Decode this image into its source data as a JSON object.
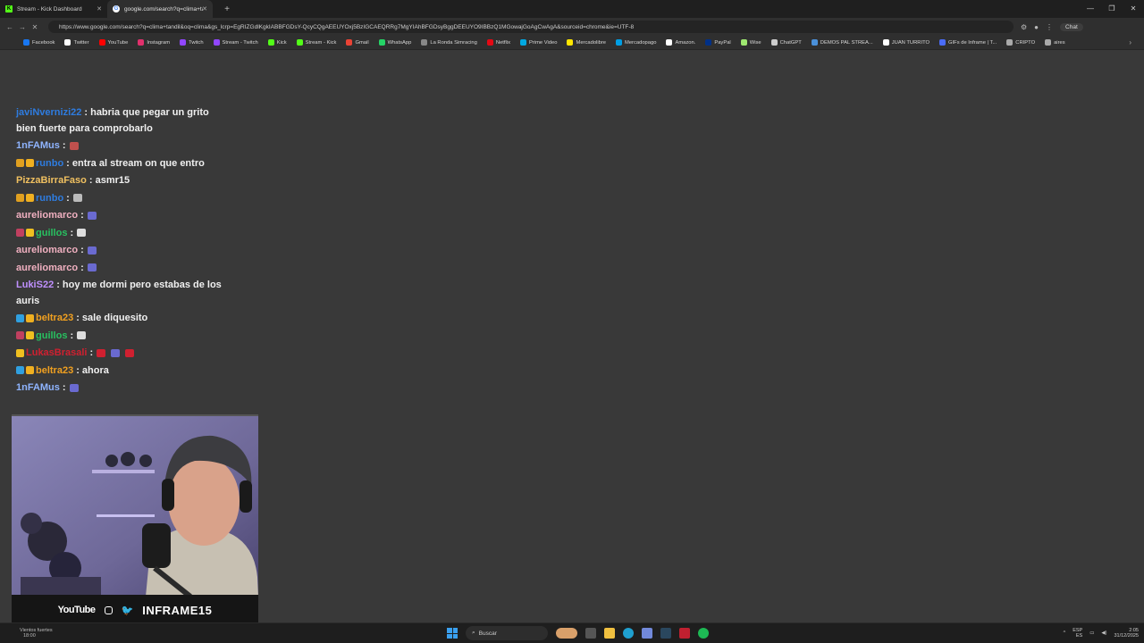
{
  "browser": {
    "tabs": [
      {
        "title": "Stream - Kick Dashboard",
        "favicon_color": "#53fc18"
      },
      {
        "title": "google.com/search?q=clima+tan",
        "favicon_color": "#4285f4"
      }
    ],
    "url": "https://www.google.com/search?q=clima+tandil&oq=clima&gs_lcrp=EgRIZGdlKgkIABBFGDsY-QcyCQgAEEUYOxj5BzIGCAEQRRg7MgYIAhBFGDsyBggDEEUYO9IBBzQ1MGowajGoAgCwAgA&sourceid=chrome&ie=UTF-8",
    "chat_button": "Chat",
    "bookmarks": [
      {
        "label": "Facebook",
        "color": "#1877f2"
      },
      {
        "label": "Twitter",
        "color": "#ffffff"
      },
      {
        "label": "YouTube",
        "color": "#ff0000"
      },
      {
        "label": "Instagram",
        "color": "#e1306c"
      },
      {
        "label": "Twitch",
        "color": "#9146ff"
      },
      {
        "label": "Stream - Twitch",
        "color": "#9146ff"
      },
      {
        "label": "Kick",
        "color": "#53fc18"
      },
      {
        "label": "Stream - Kick",
        "color": "#53fc18"
      },
      {
        "label": "Gmail",
        "color": "#ea4335"
      },
      {
        "label": "WhatsApp",
        "color": "#25d366"
      },
      {
        "label": "La Ronda Simracing",
        "color": "#888888"
      },
      {
        "label": "Netflix",
        "color": "#e50914"
      },
      {
        "label": "Prime Video",
        "color": "#00a8e1"
      },
      {
        "label": "Mercadolibre",
        "color": "#ffe600"
      },
      {
        "label": "Mercadopago",
        "color": "#009ee3"
      },
      {
        "label": "Amazon.",
        "color": "#ffffff"
      },
      {
        "label": "PayPal",
        "color": "#003087"
      },
      {
        "label": "Wise",
        "color": "#9fe870"
      },
      {
        "label": "ChatGPT",
        "color": "#cccccc"
      },
      {
        "label": "DEMOS PAL STREA...",
        "color": "#4a90d9"
      },
      {
        "label": "JUAN TURRITO",
        "color": "#ffffff"
      },
      {
        "label": "GIFs de Inframe | T...",
        "color": "#4a6cf7"
      },
      {
        "label": "CRIPTO",
        "color": "#aaaaaa"
      },
      {
        "label": "aires",
        "color": "#aaaaaa"
      }
    ]
  },
  "chat": [
    {
      "user": "javiNvernizi22",
      "color": "#2e7ce0",
      "text": ": habria que pegar un grito bien fuerte para comprobarlo",
      "badges": [],
      "emotes": []
    },
    {
      "user": "1nFAMus",
      "color": "#8fb4ff",
      "text": ":",
      "badges": [],
      "emotes": [
        "#c0504d"
      ]
    },
    {
      "user": "runbo",
      "color": "#2e7ce0",
      "text": ": entra al stream on que entro",
      "badges": [
        "#e0a020",
        "#f0b020"
      ],
      "emotes": []
    },
    {
      "user": "PizzaBirraFaso",
      "color": "#f0c060",
      "text": ": asmr15",
      "badges": [],
      "emotes": []
    },
    {
      "user": "runbo",
      "color": "#2e7ce0",
      "text": ":",
      "badges": [
        "#e0a020",
        "#f0b020"
      ],
      "emotes": [
        "#bbbbbb"
      ]
    },
    {
      "user": "aureliomarco",
      "color": "#f0b0c0",
      "text": ":",
      "badges": [],
      "emotes": [
        "#6a6ad0"
      ]
    },
    {
      "user": "guillos",
      "color": "#28c060",
      "text": ":",
      "badges": [
        "#c04060",
        "#f0c020"
      ],
      "emotes": [
        "#dddddd"
      ]
    },
    {
      "user": "aureliomarco",
      "color": "#f0b0c0",
      "text": ":",
      "badges": [],
      "emotes": [
        "#6a6ad0"
      ]
    },
    {
      "user": "aureliomarco",
      "color": "#f0b0c0",
      "text": ":",
      "badges": [],
      "emotes": [
        "#6a6ad0"
      ]
    },
    {
      "user": "LukiS22",
      "color": "#c090ff",
      "text": ": hoy me dormi pero estabas de los auris",
      "badges": [],
      "emotes": []
    },
    {
      "user": "beltra23",
      "color": "#f0a020",
      "text": ": sale diquesito",
      "badges": [
        "#30a0e0",
        "#f0b020"
      ],
      "emotes": []
    },
    {
      "user": "guillos",
      "color": "#28c060",
      "text": ":",
      "badges": [
        "#c04060",
        "#f0c020"
      ],
      "emotes": [
        "#dddddd"
      ]
    },
    {
      "user": "LukasBrasali",
      "color": "#d02030",
      "text": ":",
      "badges": [
        "#f0c020"
      ],
      "emotes": [
        "#d02030",
        "#6a6ad0",
        "#d02030"
      ]
    },
    {
      "user": "beltra23",
      "color": "#f0a020",
      "text": ": ahora",
      "badges": [
        "#30a0e0",
        "#f0b020"
      ],
      "emotes": []
    },
    {
      "user": "1nFAMus",
      "color": "#8fb4ff",
      "text": ":",
      "badges": [],
      "emotes": [
        "#6a6ad0"
      ]
    }
  ],
  "overlay": {
    "youtube": "YouTube",
    "handle": "INFRAME15"
  },
  "taskbar": {
    "weather": "Vientos fuertes",
    "weather_time": "18:00",
    "search": "Buscar",
    "lang": "ESP",
    "lang2": "ES",
    "time": "2:05",
    "date": "31/12/2025"
  }
}
